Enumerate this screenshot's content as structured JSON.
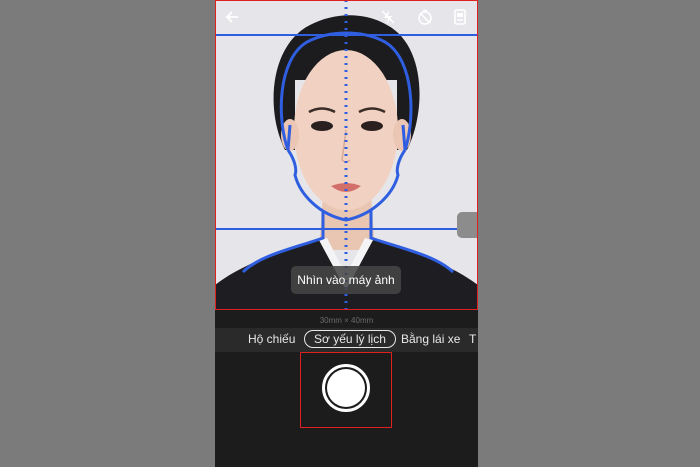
{
  "topbar": {
    "icons": [
      "back-arrow-icon",
      "flash-off-icon",
      "timer-off-icon",
      "camera-switch-icon"
    ]
  },
  "viewfinder": {
    "prompt": "Nhìn vào máy ảnh",
    "size_label": "30mm × 40mm"
  },
  "modes": {
    "items": [
      "Hộ chiếu",
      "Sơ yếu lý lịch",
      "Bằng lái xe",
      "T"
    ],
    "selected": "Sơ yếu lý lịch"
  },
  "colors": {
    "guide": "#2f5fe0",
    "highlight": "#e02020",
    "background": "#7b7b7b"
  }
}
